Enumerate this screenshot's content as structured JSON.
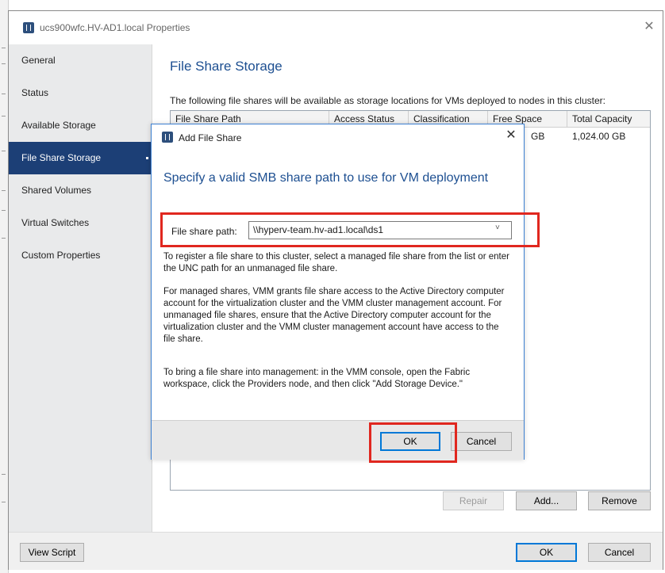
{
  "window": {
    "title": "ucs900wfc.HV-AD1.local Properties",
    "close_glyph": "✕"
  },
  "nav": {
    "items": [
      {
        "label": "General"
      },
      {
        "label": "Status"
      },
      {
        "label": "Available Storage"
      },
      {
        "label": "File Share Storage",
        "active": true
      },
      {
        "label": "Shared Volumes"
      },
      {
        "label": "Virtual Switches"
      },
      {
        "label": "Custom Properties"
      }
    ]
  },
  "content": {
    "title": "File Share Storage",
    "description": "The following file shares will be available as storage locations for VMs deployed to nodes in this cluster:",
    "table": {
      "headers": [
        "File Share Path",
        "Access Status",
        "Classification",
        "Free Space",
        "Total Capacity"
      ],
      "rows": [
        [
          "",
          "",
          "",
          "GB",
          "1,024.00 GB"
        ]
      ]
    },
    "buttons": {
      "repair": "Repair",
      "add": "Add...",
      "remove": "Remove"
    }
  },
  "footer": {
    "view_script": "View Script",
    "ok": "OK",
    "cancel": "Cancel"
  },
  "dialog": {
    "title": "Add File Share",
    "close_glyph": "✕",
    "heading": "Specify a valid SMB share path to use for VM deployment",
    "path_label": "File share path:",
    "path_value": "\\\\hyperv-team.hv-ad1.local\\ds1",
    "chevron_glyph": "˅",
    "paragraphs": [
      "To register a file share to this cluster, select a managed file share from the list or enter the UNC path for an unmanaged file share.",
      "For managed shares, VMM grants file share access to the Active Directory computer account for the virtualization cluster and the VMM cluster management account. For unmanaged file shares, ensure that the Active Directory computer account for the virtualization cluster and the VMM cluster management account have access to the file share.",
      "To bring a file share into management: in the VMM console, open the Fabric workspace, click the Providers node, and then click \"Add Storage Device.\""
    ],
    "ok": "OK",
    "cancel": "Cancel"
  },
  "icons": {
    "app": "vmm-app-icon",
    "dialog": "vmm-dialog-icon",
    "close": "close-icon",
    "chevron": "chevron-down-icon"
  },
  "colors": {
    "nav_active_bg": "#1c3f76",
    "heading_blue": "#1d4f91",
    "highlight_red": "#e0271f",
    "dialog_border": "#3c7fd1"
  }
}
